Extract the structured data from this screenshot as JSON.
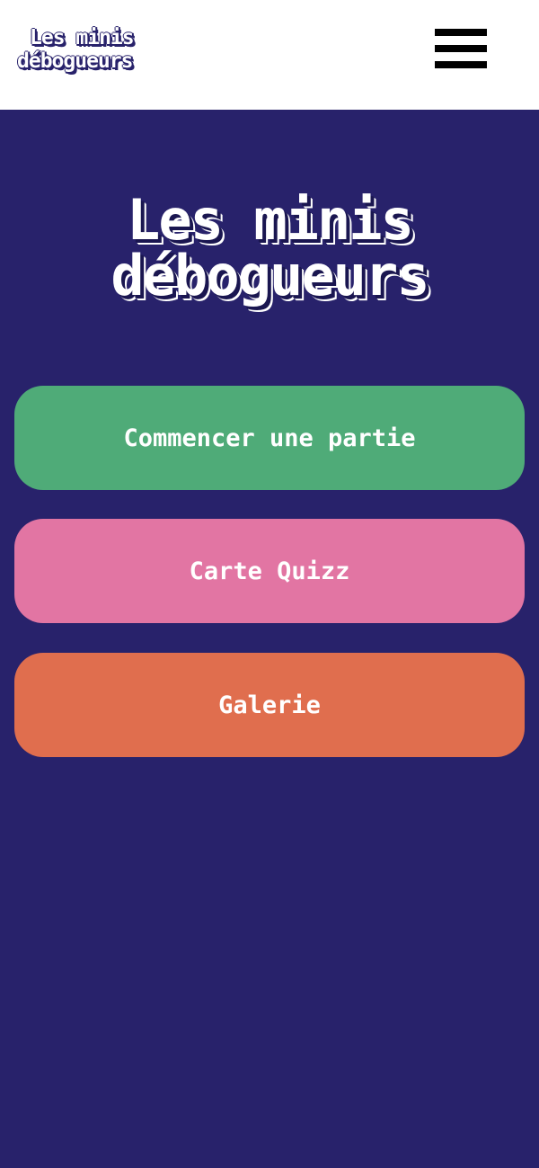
{
  "header": {
    "logo_line1": "Les minis",
    "logo_line2": "débogueurs",
    "menu_icon": "hamburger-menu-icon"
  },
  "hero": {
    "title_line1": "Les minis",
    "title_line2": "débogueurs"
  },
  "buttons": {
    "start_label": "Commencer une partie",
    "quiz_label": "Carte Quizz",
    "gallery_label": "Galerie"
  },
  "colors": {
    "background": "#28226b",
    "header_background": "#ffffff",
    "start_button": "#4fab78",
    "quiz_button": "#e275a3",
    "gallery_button": "#e06e4e",
    "button_text": "#ffffff"
  }
}
